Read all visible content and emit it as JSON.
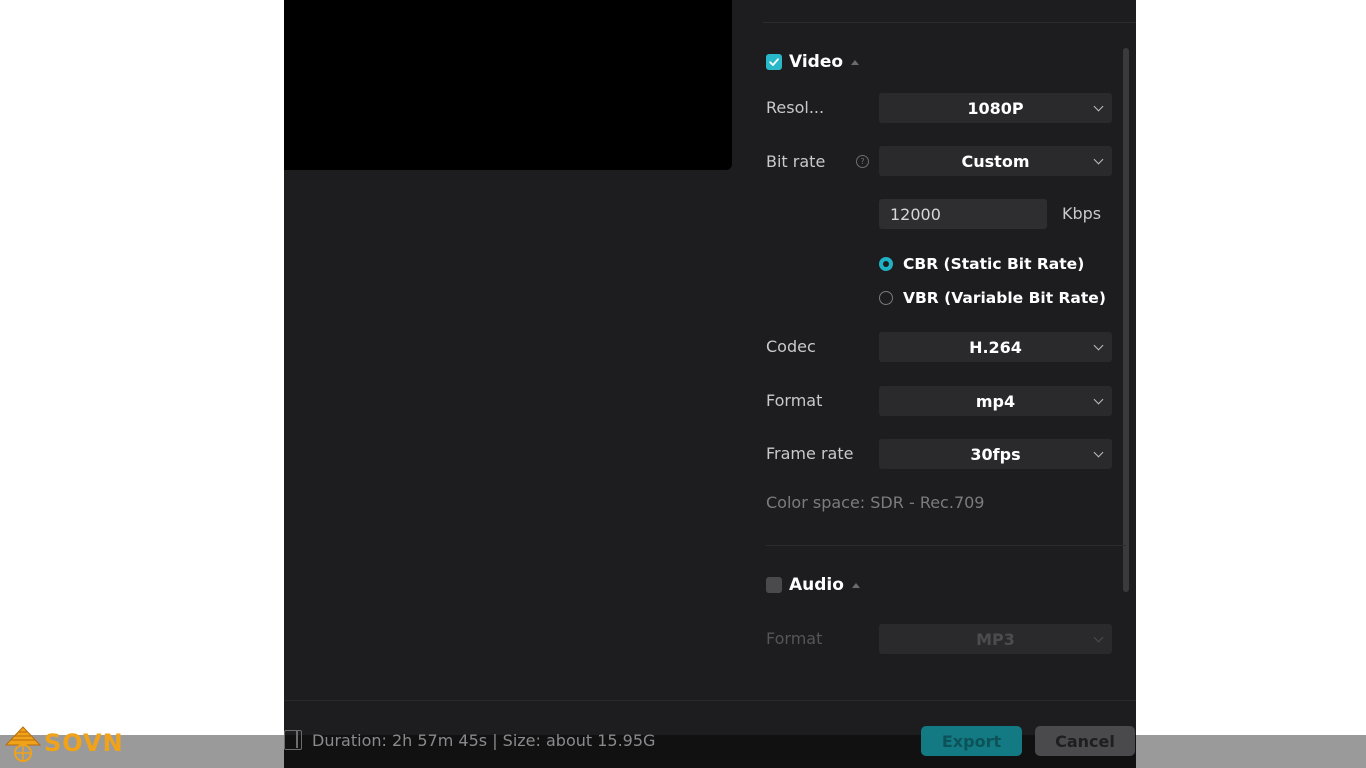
{
  "video": {
    "section_title": "Video",
    "enabled": true,
    "resolution": {
      "label": "Resol...",
      "value": "1080P"
    },
    "bit_rate": {
      "label": "Bit rate",
      "help_glyph": "?",
      "value": "Custom",
      "kbps_value": "12000",
      "unit": "Kbps"
    },
    "rate_modes": [
      {
        "label": "CBR (Static Bit Rate)",
        "selected": true
      },
      {
        "label": "VBR (Variable Bit Rate)",
        "selected": false
      }
    ],
    "codec": {
      "label": "Codec",
      "value": "H.264"
    },
    "format": {
      "label": "Format",
      "value": "mp4"
    },
    "frame_rate": {
      "label": "Frame rate",
      "value": "30fps"
    },
    "color_space": "Color space: SDR - Rec.709"
  },
  "audio": {
    "section_title": "Audio",
    "enabled": false,
    "format": {
      "label": "Format",
      "value": "MP3"
    }
  },
  "footer": {
    "status": "Duration: 2h 57m 45s | Size: about 15.95G",
    "export_label": "Export",
    "cancel_label": "Cancel"
  },
  "watermark": {
    "text": "SOVN"
  },
  "colors": {
    "accent": "#29b8c8",
    "dialog_bg": "#1d1d1f",
    "field_bg": "#2a2a2d",
    "logo": "#f0a21a"
  }
}
